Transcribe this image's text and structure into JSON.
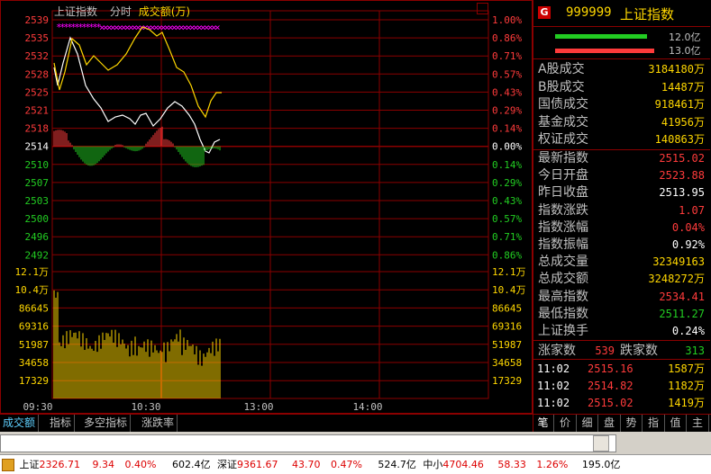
{
  "chart": {
    "title": "上证指数",
    "mode": "分时",
    "metric": "成交额(万)",
    "close_icon": "close-icon",
    "price_ticks": [
      "2539",
      "2535",
      "2532",
      "2528",
      "2525",
      "2521",
      "2518",
      "2514",
      "2510",
      "2507",
      "2503",
      "2500",
      "2496",
      "2492"
    ],
    "pct_ticks": [
      "1.00%",
      "0.86%",
      "0.71%",
      "0.57%",
      "0.43%",
      "0.29%",
      "0.14%",
      "0.00%",
      "0.14%",
      "0.29%",
      "0.43%",
      "0.57%",
      "0.71%",
      "0.86%"
    ],
    "vol_ticks": [
      "12.1万",
      "10.4万",
      "86645",
      "69316",
      "51987",
      "34658",
      "17329"
    ],
    "time_ticks": [
      "09:30",
      "10:30",
      "13:00",
      "14:00"
    ],
    "colors": {
      "grid": "#8b0000",
      "up": "#ff3b3b",
      "down": "#22cc22",
      "price_line": "#ffffff",
      "avg_line": "#ffd700",
      "volume": "#ffd700",
      "marker": "#ff00ff"
    }
  },
  "panel": {
    "code": "999999",
    "name": "上证指数",
    "badge": "G",
    "bar1_value": "12.0亿",
    "bar2_value": "13.0亿",
    "turnover": [
      {
        "label": "A股成交",
        "value": "3184180万"
      },
      {
        "label": "B股成交",
        "value": "14487万"
      },
      {
        "label": "国债成交",
        "value": "918461万"
      },
      {
        "label": "基金成交",
        "value": "41956万"
      },
      {
        "label": "权证成交",
        "value": "140863万"
      }
    ],
    "stats": [
      {
        "label": "最新指数",
        "value": "2515.02",
        "color": "r"
      },
      {
        "label": "今日开盘",
        "value": "2523.88",
        "color": "r"
      },
      {
        "label": "昨日收盘",
        "value": "2513.95",
        "color": "w"
      },
      {
        "label": "指数涨跌",
        "value": "1.07",
        "color": "r"
      },
      {
        "label": "指数涨幅",
        "value": "0.04%",
        "color": "r"
      },
      {
        "label": "指数振幅",
        "value": "0.92%",
        "color": "w"
      },
      {
        "label": "总成交量",
        "value": "32349163",
        "color": "y"
      },
      {
        "label": "总成交额",
        "value": "3248272万",
        "color": "y"
      },
      {
        "label": "最高指数",
        "value": "2534.41",
        "color": "r"
      },
      {
        "label": "最低指数",
        "value": "2511.27",
        "color": "g"
      },
      {
        "label": "上证换手",
        "value": "0.24%",
        "color": "w"
      }
    ],
    "up_label": "涨家数",
    "up_count": "539",
    "down_label": "跌家数",
    "down_count": "313",
    "ticks": [
      {
        "time": "11:02",
        "price": "2515.16",
        "vol": "1587万"
      },
      {
        "time": "11:02",
        "price": "2514.82",
        "vol": "1182万"
      },
      {
        "time": "11:02",
        "price": "2515.02",
        "vol": "1419万"
      }
    ]
  },
  "tabs": [
    "成交额",
    "指标",
    "多空指标",
    "涨跌率"
  ],
  "right_tabs": [
    "笔",
    "价",
    "细",
    "盘",
    "势",
    "指",
    "值",
    "主"
  ],
  "ticker": {
    "sh_label": "上证",
    "sh_value": "2326.71",
    "sh_chg": "9.34",
    "sh_pct": "0.40%",
    "sh_amt": "602.4亿",
    "sz_label": "深证",
    "sz_value": "9361.67",
    "sz_chg": "43.70",
    "sz_pct": "0.47%",
    "sz_amt": "524.7亿",
    "zx_label": "中小",
    "zx_value": "4704.46",
    "zx_chg": "58.33",
    "zx_pct": "1.26%",
    "zx_amt": "195.0亿"
  }
}
